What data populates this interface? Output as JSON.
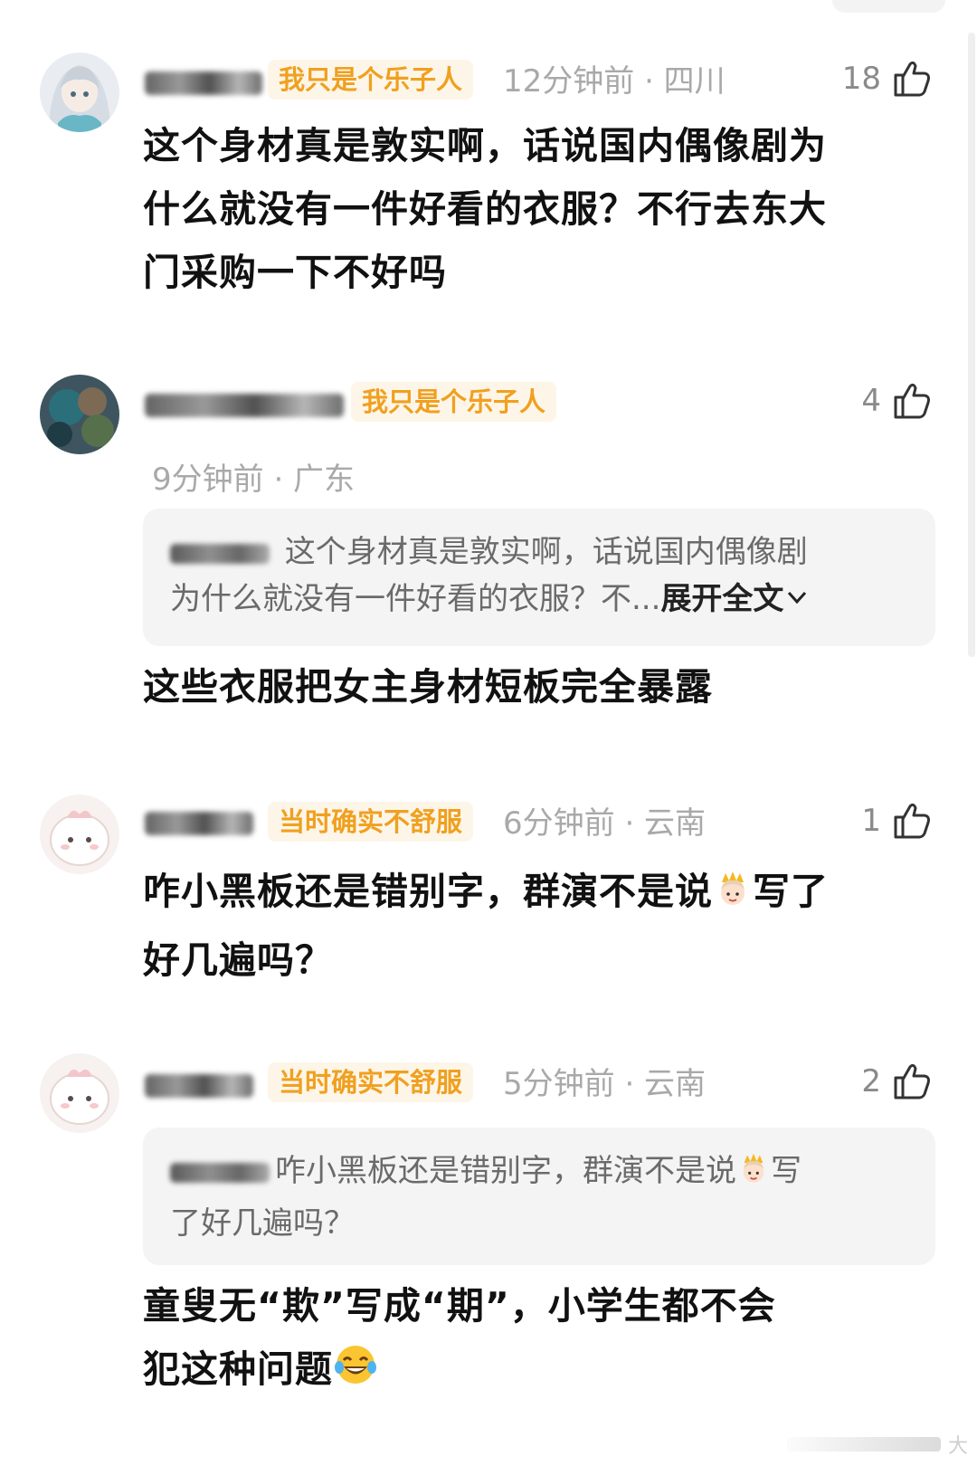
{
  "comments": [
    {
      "username": "****",
      "badge": "我只是个乐子人",
      "meta": "12分钟前 · 四川",
      "likes": "18",
      "text_lines": [
        "这个身材真是敦实啊，话说国内偶像剧为",
        "什么就没有一件好看的衣服？不行去东大",
        "门采购一下不好吗"
      ]
    },
    {
      "username": "****",
      "badge": "我只是个乐子人",
      "meta": "9分钟前 · 广东",
      "likes": "4",
      "quote": {
        "name": "****:",
        "line1": " 这个身材真是敦实啊，话说国内偶像剧",
        "line2": "为什么就没有一件好看的衣服？不",
        "ellipsis": "...",
        "expand": "展开全文"
      },
      "text_lines": [
        "这些衣服把女主身材短板完全暴露"
      ]
    },
    {
      "username": "****",
      "badge": "当时确实不舒服",
      "meta": "6分钟前 · 云南",
      "likes": "1",
      "text_line1_a": "咋小黑板还是错别字，群演不是说",
      "text_line1_b": "写了",
      "text_line2": "好几遍吗？"
    },
    {
      "username": "****",
      "badge": "当时确实不舒服",
      "meta": "5分钟前 · 云南",
      "likes": "2",
      "quote": {
        "name": "****:",
        "line1_a": "咋小黑板还是错别字，群演不是说",
        "line1_b": "写",
        "line2": "了好几遍吗？"
      },
      "text_line1": "童叟无“欺”写成“期”，小学生都不会",
      "text_line2": "犯这种问题"
    }
  ],
  "icons": {
    "like": "thumbs-up-icon",
    "expand": "chevron-down-icon",
    "princess_emoji": "princess-emoji-icon",
    "laugh_emoji": "tears-of-joy-emoji-icon"
  },
  "colors": {
    "badge_text": "#f0a020",
    "badge_bg": "#fdf6e8",
    "meta": "#a9a9a9",
    "quote_bg": "#f4f4f4"
  },
  "watermark": "大"
}
